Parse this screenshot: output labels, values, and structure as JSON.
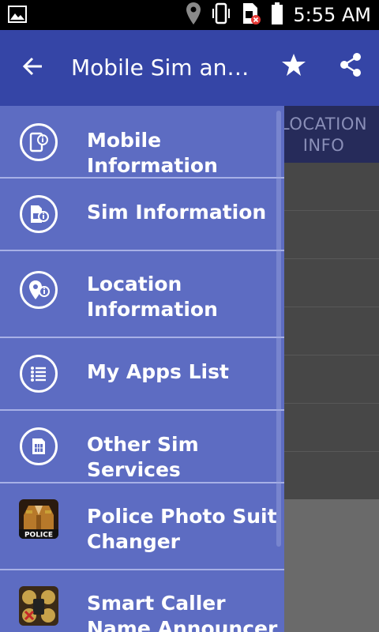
{
  "status_bar": {
    "time": "5:55 AM",
    "icons": [
      "image-icon",
      "location-pin-icon",
      "vibrate-icon",
      "sim-error-icon",
      "battery-icon"
    ]
  },
  "app_bar": {
    "title": "Mobile Sim and Location Info",
    "back_icon": "arrow-left-icon",
    "favorite_icon": "star-icon",
    "share_icon": "share-icon"
  },
  "background": {
    "tab_label": "LOCATION INFO"
  },
  "drawer": {
    "items": [
      {
        "label": "Mobile Information",
        "icon": "mobile-info-icon"
      },
      {
        "label": "Sim Information",
        "icon": "sim-info-icon"
      },
      {
        "label": "Location Information",
        "icon": "location-info-icon"
      },
      {
        "label": "My Apps List",
        "icon": "list-icon"
      },
      {
        "label": "Other Sim Services",
        "icon": "sim-card-icon"
      },
      {
        "label": "Police Photo Suit Changer",
        "icon": "police-suit-app-icon"
      },
      {
        "label": "Smart Caller Name Announcer",
        "icon": "caller-announcer-app-icon"
      }
    ]
  },
  "colors": {
    "app_bar": "#3545a6",
    "drawer": "#5d6cc2",
    "divider": "#a7b0e6",
    "status_bar": "#000000"
  }
}
